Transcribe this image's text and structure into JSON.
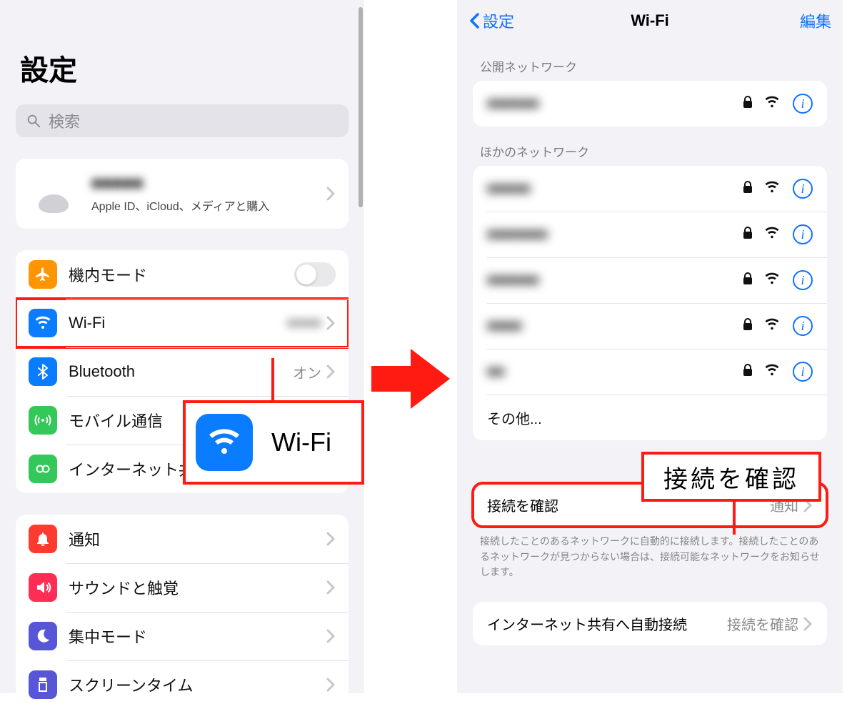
{
  "left": {
    "title": "設定",
    "search_placeholder": "検索",
    "profile": {
      "name": "■■■■■",
      "subtitle": "Apple ID、iCloud、メディアと購入"
    },
    "group1": {
      "airplane": "機内モード",
      "wifi": "Wi-Fi",
      "wifi_value": "■■■■",
      "bluetooth": "Bluetooth",
      "bluetooth_value": "オン",
      "cellular": "モバイル通信",
      "hotspot": "インターネット共有"
    },
    "group2": {
      "notifications": "通知",
      "sounds": "サウンドと触覚",
      "focus": "集中モード",
      "screentime": "スクリーンタイム"
    },
    "callout_label": "Wi-Fi"
  },
  "right": {
    "back": "設定",
    "title": "Wi-Fi",
    "edit": "編集",
    "section_public": "公開ネットワーク",
    "public_net": "■■■■■■",
    "section_other": "ほかのネットワーク",
    "nets": [
      "■■■■■",
      "■■■■■■■",
      "■■■■■■",
      "■■■■",
      "■■"
    ],
    "other": "その他...",
    "ask_label": "接続を確認",
    "ask_value": "通知",
    "footer": "接続したことのあるネットワークに自動的に接続します。接続したことのあるネットワークが見つからない場合は、接続可能なネットワークをお知らせします。",
    "auto_hotspot_label": "インターネット共有へ自動接続",
    "auto_hotspot_value": "接続を確認",
    "callout_label": "接続を確認"
  },
  "icons": {
    "colors": {
      "airplane": "#ff9502",
      "wifi": "#0a7cff",
      "bluetooth": "#0a7cff",
      "cellular": "#34c759",
      "hotspot": "#34c759",
      "notifications": "#ff3b30",
      "sounds": "#ff2d55",
      "focus": "#5856d6",
      "screentime": "#5856d6"
    }
  }
}
